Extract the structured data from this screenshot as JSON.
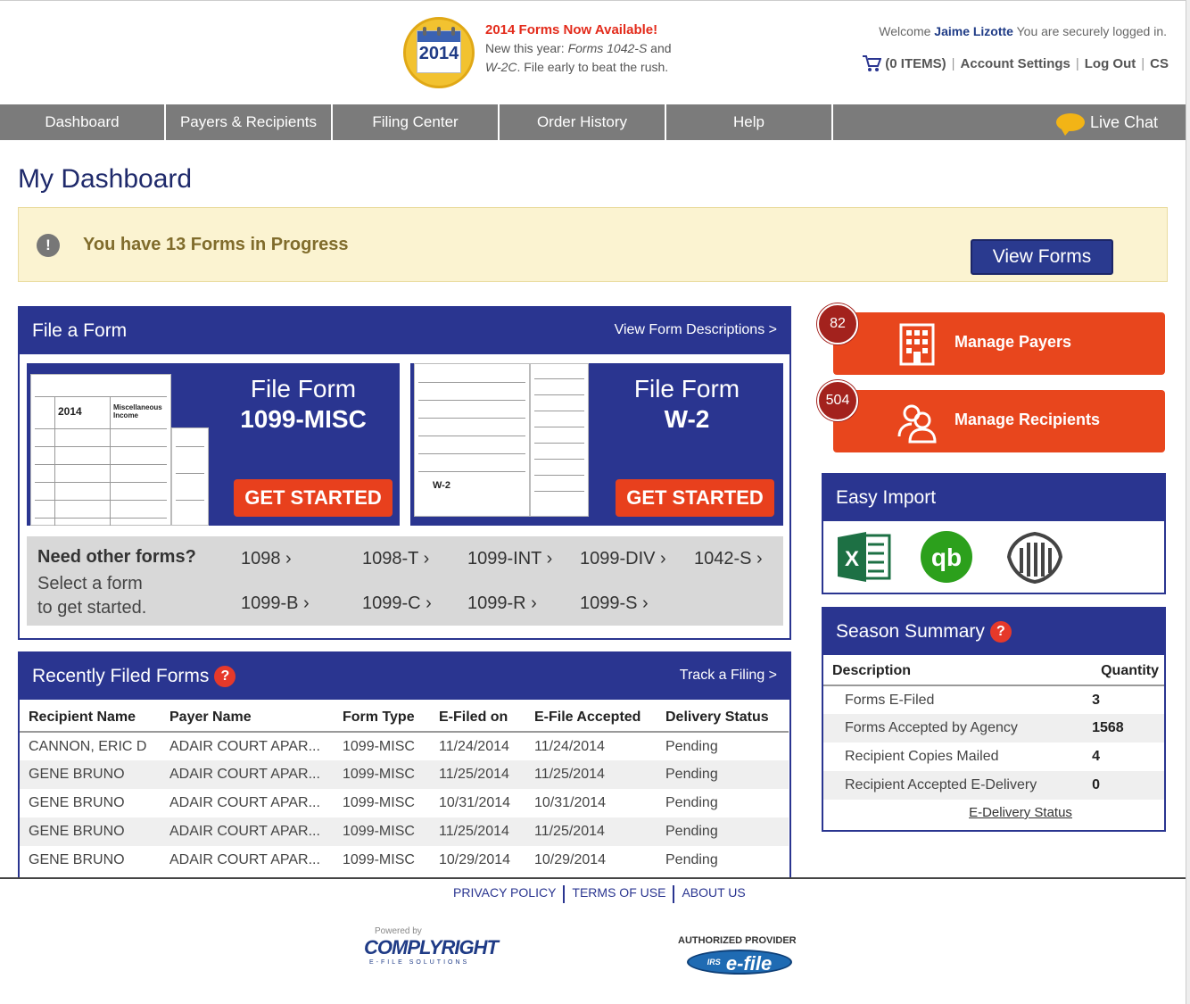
{
  "header": {
    "calendar_year": "2014",
    "promo_title": "2014 Forms Now Available!",
    "promo_line1": "New this year: ",
    "promo_forms_a": "Forms 1042-S",
    "promo_and": " and",
    "promo_forms_b": "W-2C",
    "promo_line2": ". File early to beat the rush.",
    "welcome_prefix": "Welcome ",
    "user_name": "Jaime Lizotte",
    "welcome_suffix": " You are securely logged in.",
    "cart": "(0 ITEMS)",
    "account_settings": "Account Settings",
    "log_out": "Log Out",
    "cs": "CS"
  },
  "nav": {
    "items": [
      "Dashboard",
      "Payers & Recipients",
      "Filing Center",
      "Order History",
      "Help"
    ],
    "live_chat": "Live Chat"
  },
  "page_title": "My Dashboard",
  "alert": {
    "icon": "!",
    "text": "You have 13 Forms in Progress",
    "button": "View Forms"
  },
  "file_form": {
    "title": "File a Form",
    "link": "View Form Descriptions >",
    "cards": [
      {
        "line1": "File Form",
        "line2": "1099-MISC",
        "button": "GET STARTED",
        "paper_year": "2014",
        "paper_label": "Miscellaneous Income"
      },
      {
        "line1": "File Form",
        "line2": "W-2",
        "button": "GET STARTED",
        "paper_label": "W-2"
      }
    ],
    "other_title": "Need other forms?",
    "other_sub1": "Select a form",
    "other_sub2": "to get started.",
    "links": [
      "1098 ›",
      "1098-T ›",
      "1099-INT ›",
      "1099-DIV ›",
      "1042-S ›",
      "1099-B ›",
      "1099-C ›",
      "1099-R ›",
      "1099-S ›"
    ]
  },
  "recent": {
    "title": "Recently Filed Forms",
    "help": "?",
    "link": "Track a Filing >",
    "columns": [
      "Recipient Name",
      "Payer Name",
      "Form Type",
      "E-Filed on",
      "E-File Accepted",
      "Delivery Status"
    ],
    "rows": [
      [
        "CANNON, ERIC D",
        "ADAIR COURT APAR...",
        "1099-MISC",
        "11/24/2014",
        "11/24/2014",
        "Pending"
      ],
      [
        "GENE BRUNO",
        "ADAIR COURT APAR...",
        "1099-MISC",
        "11/25/2014",
        "11/25/2014",
        "Pending"
      ],
      [
        "GENE BRUNO",
        "ADAIR COURT APAR...",
        "1099-MISC",
        "10/31/2014",
        "10/31/2014",
        "Pending"
      ],
      [
        "GENE BRUNO",
        "ADAIR COURT APAR...",
        "1099-MISC",
        "11/25/2014",
        "11/25/2014",
        "Pending"
      ],
      [
        "GENE BRUNO",
        "ADAIR COURT APAR...",
        "1099-MISC",
        "10/29/2014",
        "10/29/2014",
        "Pending"
      ]
    ]
  },
  "manage": {
    "payers_count": "82",
    "payers_label": "Manage Payers",
    "recipients_count": "504",
    "recipients_label": "Manage Recipients"
  },
  "easy_import": {
    "title": "Easy Import",
    "icons": [
      "excel-icon",
      "quickbooks-icon",
      "irs-eagle-icon"
    ],
    "excel_letter": "X",
    "qb_letters": "qb"
  },
  "season": {
    "title": "Season Summary",
    "help": "?",
    "col_desc": "Description",
    "col_qty": "Quantity",
    "rows": [
      {
        "desc": "Forms E-Filed",
        "qty": "3"
      },
      {
        "desc": "Forms Accepted by Agency",
        "qty": "1568"
      },
      {
        "desc": "Recipient Copies Mailed",
        "qty": "4"
      },
      {
        "desc": "Recipient Accepted E-Delivery",
        "qty": "0"
      }
    ],
    "link": "E-Delivery Status"
  },
  "footer": {
    "privacy": "PRIVACY POLICY",
    "terms": "TERMS OF USE",
    "about": "ABOUT US",
    "powered_by": "Powered by",
    "complyright": "COMPLYRIGHT",
    "complyright_sub": "E-FILE SOLUTIONS",
    "authorized": "AUTHORIZED PROVIDER",
    "efile": "e-file",
    "efile_irs": "IRS"
  },
  "colors": {
    "navy": "#2a3590",
    "orange": "#e8461d",
    "nav_gray": "#7b7b7b",
    "alert_bg": "#fbf3d1",
    "badge_red": "#a3221d"
  }
}
